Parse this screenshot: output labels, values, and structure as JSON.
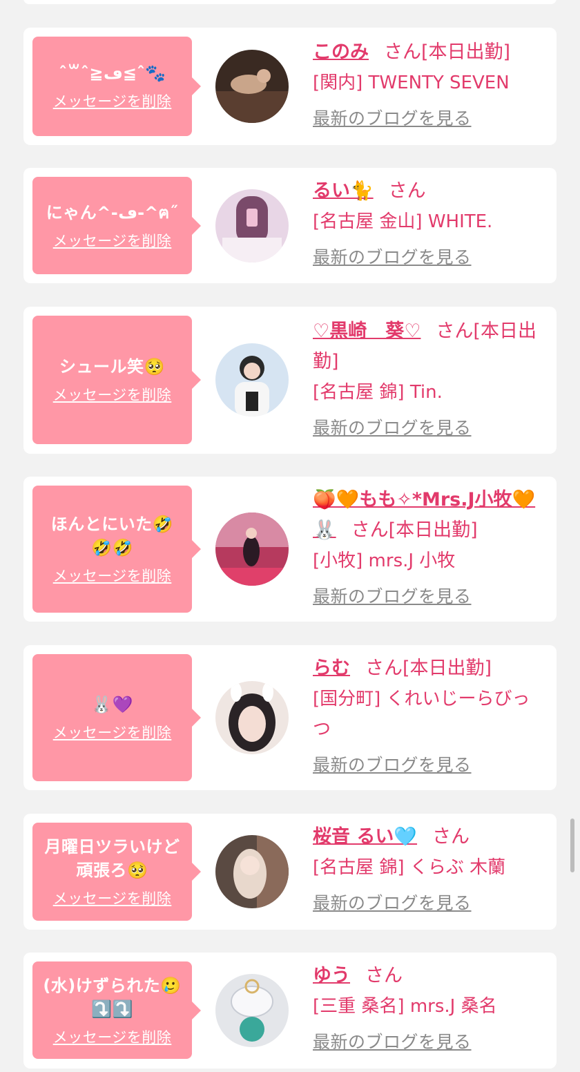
{
  "delete_label": "メッセージを削除",
  "blog_label": "最新のブログを見る",
  "san_label": "さん",
  "colors": {
    "accent": "#e23a6b",
    "bubble": "#ff97a6",
    "background": "#f2f2f2"
  },
  "cards": [
    {
      "message": "ˆ꒳ˆ≧ڡ≦ˆ🐾",
      "name": "このみ",
      "status": "[本日出勤]",
      "shop": "[関内] TWENTY SEVEN"
    },
    {
      "message": "にゃん^-ڡ-^ฅ˝",
      "name": "るい🐈",
      "status": "",
      "shop": "[名古屋 金山] WHITE."
    },
    {
      "message": "シュール笑🥺",
      "name": "♡黒崎　葵♡",
      "status": "[本日出勤]",
      "shop": "[名古屋 錦] Tin."
    },
    {
      "message": "ほんとにいた🤣🤣🤣",
      "name": "🍑🧡もも✧*Mrs.J小牧🧡🐰",
      "status": "[本日出勤]",
      "shop": "[小牧] mrs.J 小牧"
    },
    {
      "message": "🐰💜",
      "name": "らむ",
      "status": "[本日出勤]",
      "shop": "[国分町] くれいじーらびっつ"
    },
    {
      "message": "月曜日ツラいけど頑張ろ🥺",
      "name": "桜音 るい🩵",
      "status": "",
      "shop": "[名古屋 錦] くらぶ 木蘭"
    },
    {
      "message": "(水)けずられた🥲⤵️⤵️",
      "name": "ゆう",
      "status": "",
      "shop": "[三重 桑名] mrs.J 桑名"
    }
  ]
}
